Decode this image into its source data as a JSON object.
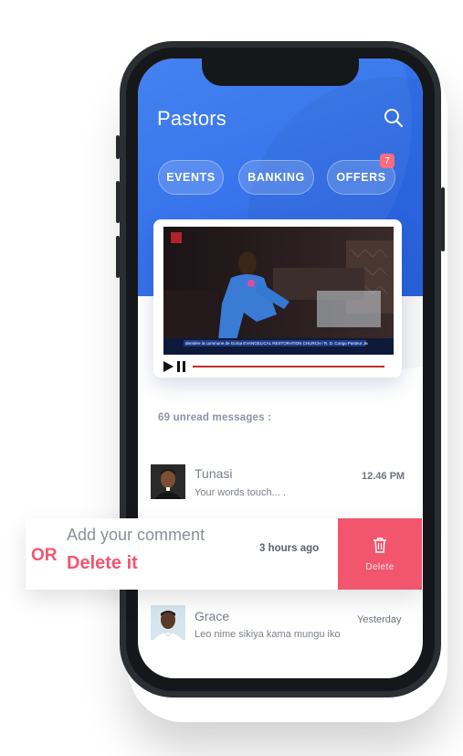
{
  "app": {
    "title": "Pastors"
  },
  "filters": [
    {
      "label": "EVENTS"
    },
    {
      "label": "BANKING"
    },
    {
      "label": "OFFERS",
      "badge": "7"
    }
  ],
  "video": {
    "caption": "dernière la commune de Goma EVANGELICAL RESTORATION CHURCH / R. D. Congo Pasteur Jea",
    "progress": 1.0
  },
  "messages_header": "69 unread messages :",
  "messages": [
    {
      "name": "Tunasi",
      "preview": "Your words touch... .",
      "time": "12.46 PM"
    },
    {
      "time": "3 hours ago"
    },
    {
      "name": "Grace",
      "preview": "Leo nime sikiya kama mungu iko",
      "time": "Yesterday"
    }
  ],
  "swipe_overlay": {
    "comment_label": "Add your comment",
    "or_label": "OR",
    "delete_label": "Delete it",
    "delete_button_label": "Delete"
  },
  "colors": {
    "primary": "#2d6cea",
    "accent": "#f2566e"
  }
}
